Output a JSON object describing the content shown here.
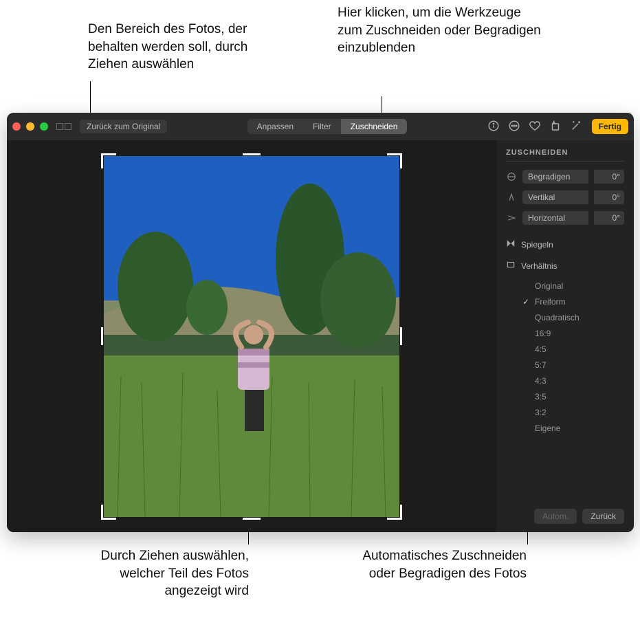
{
  "callouts": {
    "topLeft": "Den Bereich des Fotos, der behalten werden soll, durch Ziehen auswählen",
    "topRight": "Hier klicken, um die Werkzeuge zum Zuschneiden oder Begradigen einzublenden",
    "bottomLeft": "Durch Ziehen auswählen, welcher Teil des Fotos angezeigt wird",
    "bottomRight": "Automatisches Zuschneiden oder Begradigen des Fotos"
  },
  "toolbar": {
    "revert": "Zurück zum Original",
    "tabs": {
      "adjust": "Anpassen",
      "filter": "Filter",
      "crop": "Zuschneiden"
    },
    "done": "Fertig"
  },
  "sidebar": {
    "title": "ZUSCHNEIDEN",
    "sliders": {
      "straighten": {
        "label": "Begradigen",
        "value": "0°"
      },
      "vertical": {
        "label": "Vertikal",
        "value": "0°"
      },
      "horizontal": {
        "label": "Horizontal",
        "value": "0°"
      }
    },
    "flipLabel": "Spiegeln",
    "aspectLabel": "Verhältnis",
    "aspects": [
      {
        "label": "Original",
        "selected": false
      },
      {
        "label": "Freiform",
        "selected": true
      },
      {
        "label": "Quadratisch",
        "selected": false
      },
      {
        "label": "16:9",
        "selected": false
      },
      {
        "label": "4:5",
        "selected": false
      },
      {
        "label": "5:7",
        "selected": false
      },
      {
        "label": "4:3",
        "selected": false
      },
      {
        "label": "3:5",
        "selected": false
      },
      {
        "label": "3:2",
        "selected": false
      },
      {
        "label": "Eigene",
        "selected": false
      }
    ],
    "autoLabel": "Autom.",
    "resetLabel": "Zurück"
  }
}
